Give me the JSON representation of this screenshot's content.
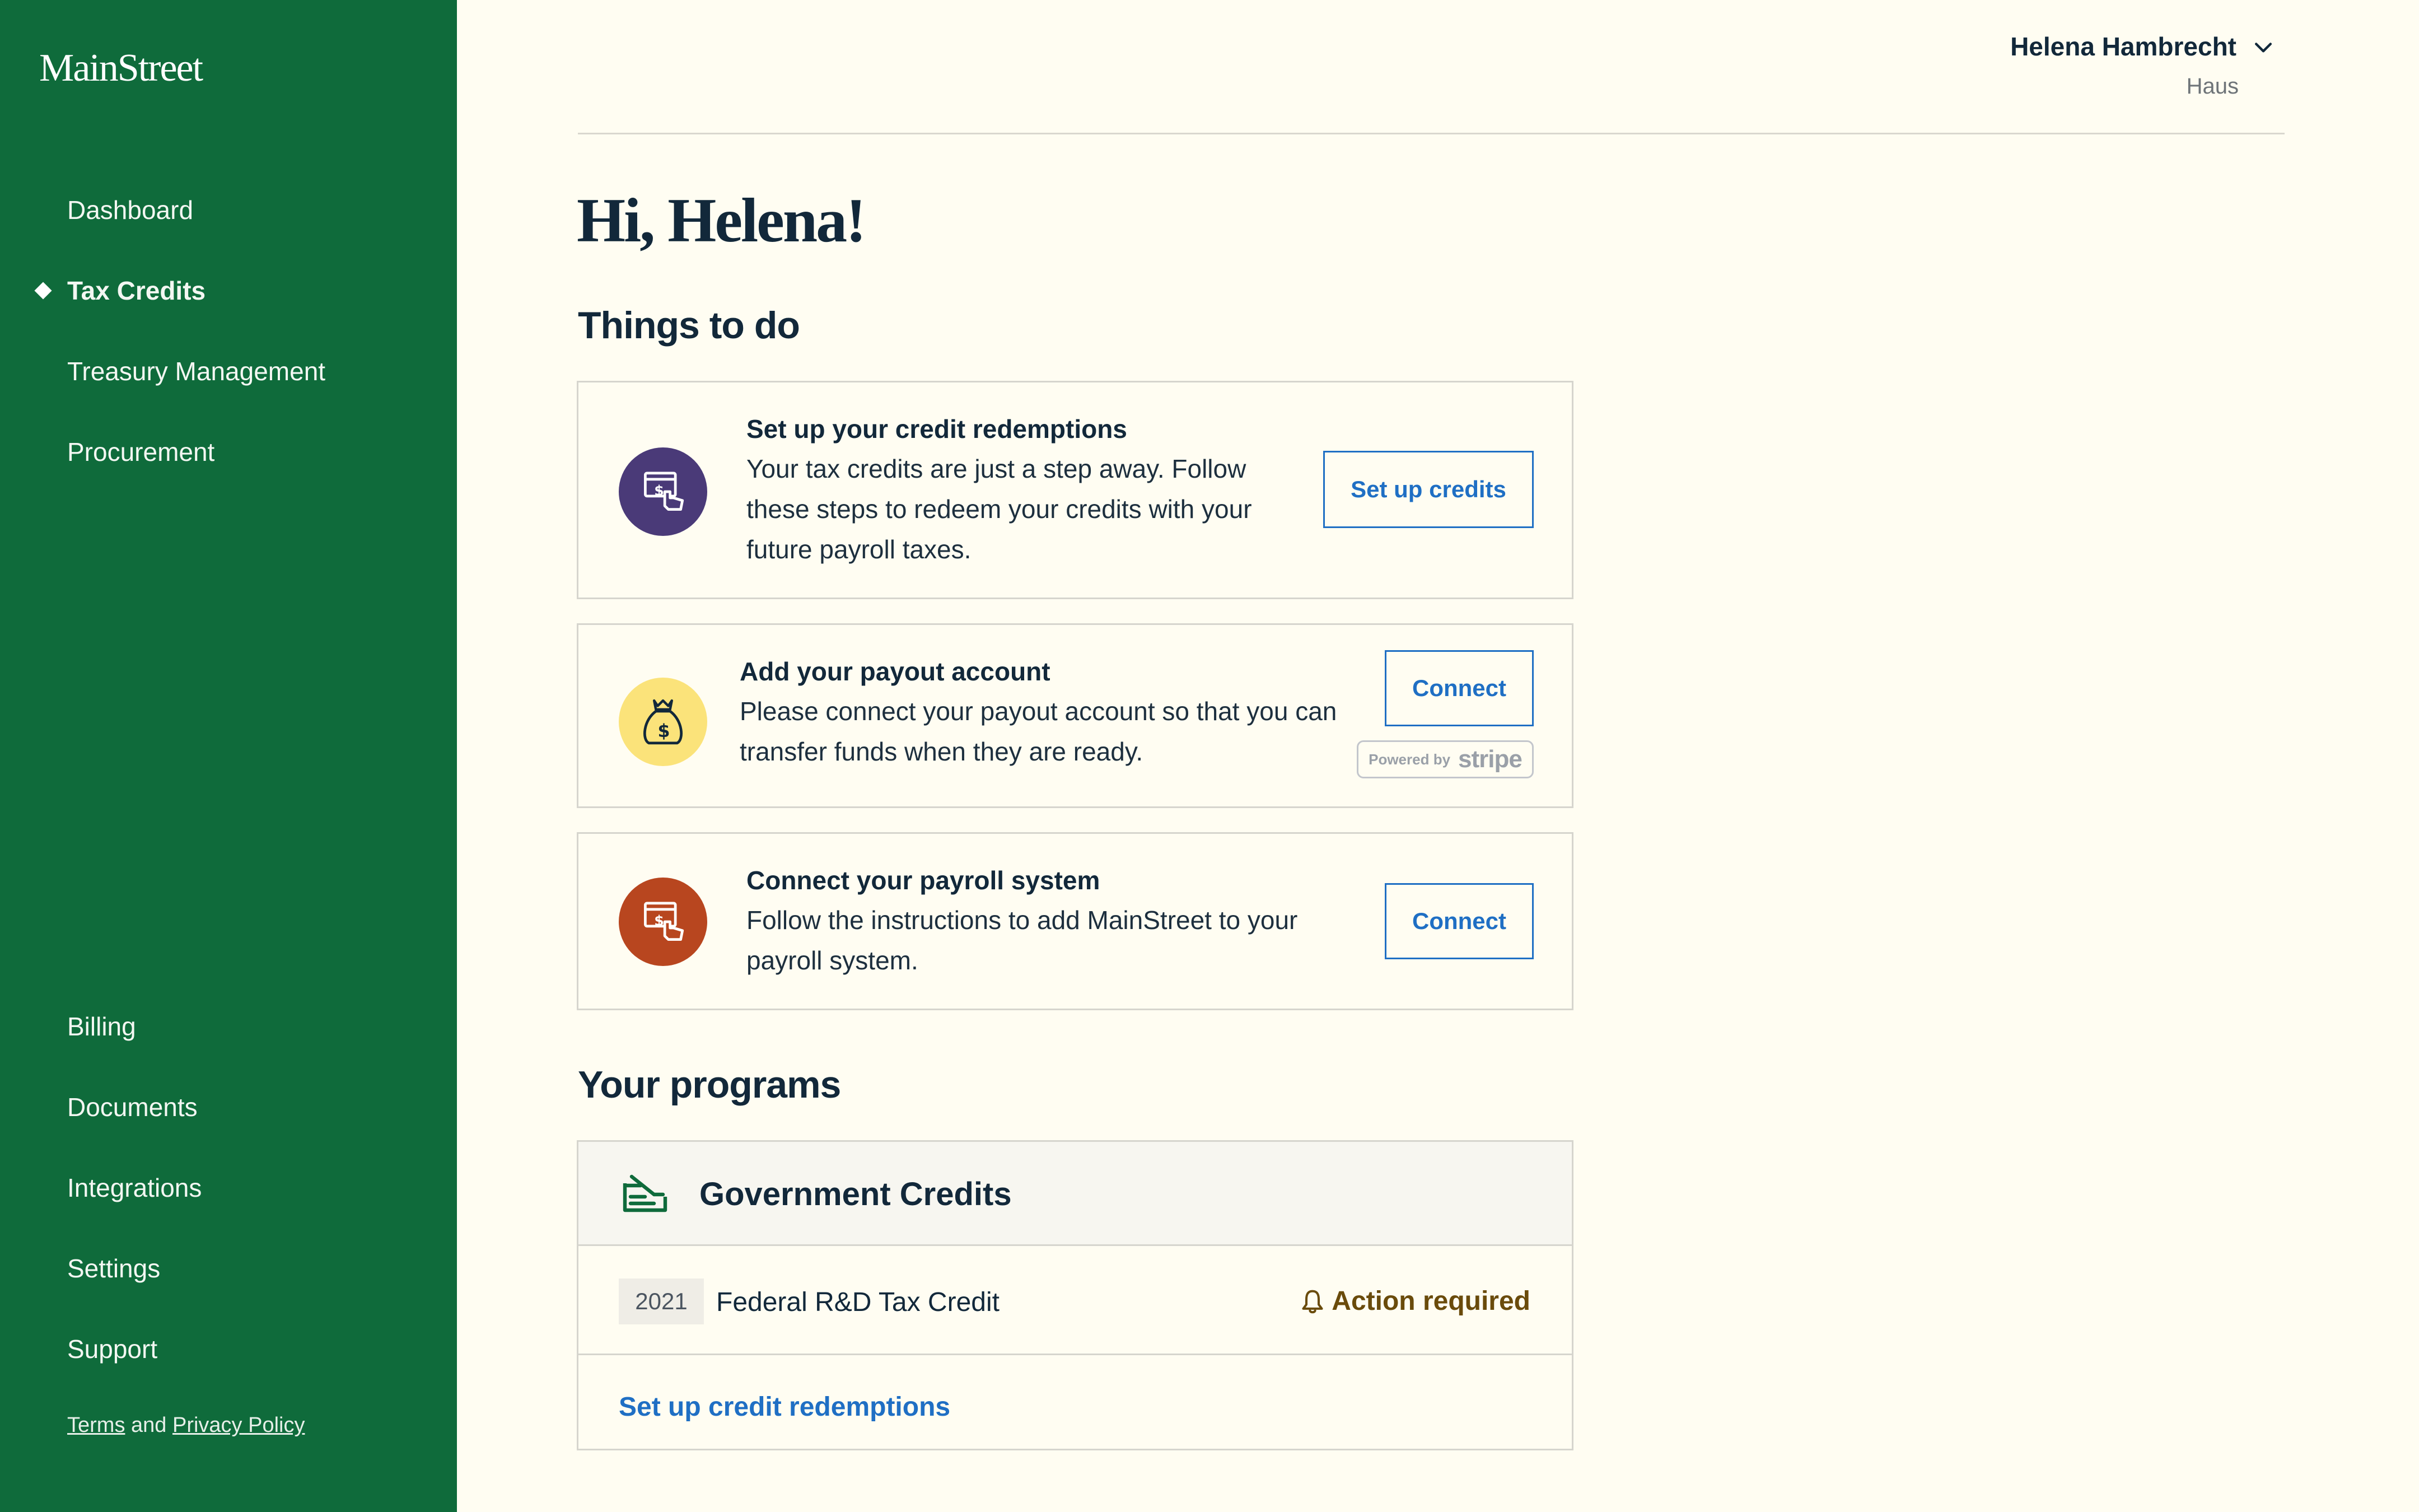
{
  "sidebar": {
    "logo": "MainStreet",
    "nav_top": [
      {
        "label": "Dashboard",
        "active": false
      },
      {
        "label": "Tax Credits",
        "active": true
      },
      {
        "label": "Treasury Management",
        "active": false
      },
      {
        "label": "Procurement",
        "active": false
      }
    ],
    "nav_bottom": [
      {
        "label": "Billing"
      },
      {
        "label": "Documents"
      },
      {
        "label": "Integrations"
      },
      {
        "label": "Settings"
      },
      {
        "label": "Support"
      }
    ],
    "legal": {
      "terms": "Terms",
      "and": "and",
      "privacy": "Privacy Policy"
    }
  },
  "header": {
    "user_name": "Helena Hambrecht",
    "org_name": "Haus"
  },
  "main": {
    "greeting": "Hi, Helena!",
    "todo_title": "Things to do",
    "todos": [
      {
        "title": "Set up your credit redemptions",
        "description": "Your tax credits are just a step away. Follow these steps to redeem your credits with your future payroll taxes.",
        "button": "Set up credits",
        "icon": "credit-redemption-icon",
        "icon_color": "#4a3a78"
      },
      {
        "title": "Add your payout account",
        "description": "Please connect your payout account so that you can transfer funds when they are ready.",
        "button": "Connect",
        "icon": "money-bag-icon",
        "icon_color": "#fbe37a",
        "badge_prefix": "Powered by",
        "badge_brand": "stripe"
      },
      {
        "title": "Connect your payroll system",
        "description": "Follow the instructions to add MainStreet to your payroll system.",
        "button": "Connect",
        "icon": "payroll-icon",
        "icon_color": "#b8461f"
      }
    ],
    "programs_title": "Your programs",
    "program": {
      "title": "Government Credits",
      "year": "2021",
      "credit_name": "Federal R&D Tax Credit",
      "status": "Action required",
      "link": "Set up credit redemptions"
    }
  },
  "colors": {
    "sidebar_bg": "#0f6b3b",
    "page_bg": "#fffdf2",
    "accent_blue": "#1f6fc4",
    "action_brown": "#6a4b0b"
  }
}
